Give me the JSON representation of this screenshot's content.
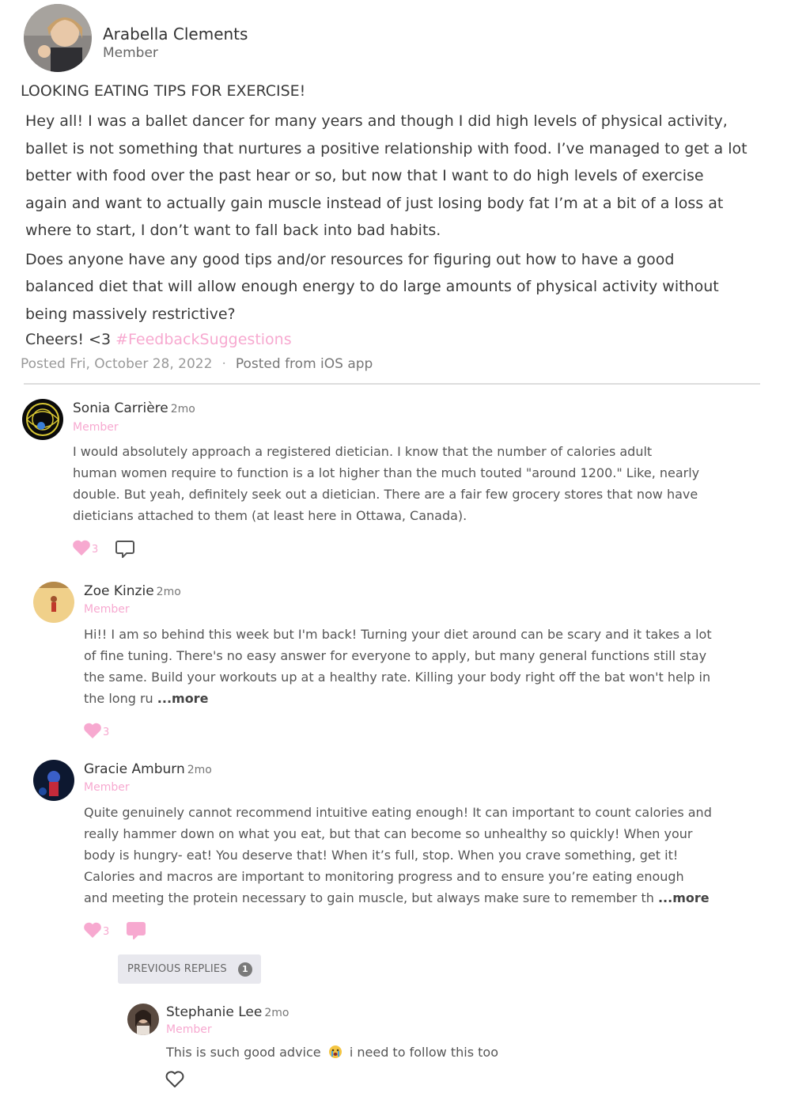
{
  "post": {
    "author": "Arabella Clements",
    "role": "Member",
    "title": "LOOKING EATING TIPS FOR EXERCISE!",
    "lines1": [
      "Hey all! I was a ballet dancer for many years and though I did high levels of physical activity,",
      "ballet is not something that nurtures a positive relationship with food. I’ve managed to get a lot",
      "better with food over the past hear or so, but now that I want to do high levels of exercise",
      "again and want to actually gain muscle instead of just losing body fat I’m at a bit of a loss at",
      "where to start, I don’t want to fall back into bad habits."
    ],
    "lines2": [
      "Does anyone have any good tips and/or resources for figuring out how to have a good",
      "balanced diet that will allow enough energy to do large amounts of physical activity without",
      "being massively restrictive?"
    ],
    "closing": "Cheers! <3",
    "hashtag": "#FeedbackSuggestions",
    "posted": "Posted Fri, October 28, 2022",
    "dot": "·",
    "source": "Posted from iOS app"
  },
  "comments": [
    {
      "name": "Sonia Carrière",
      "time": "2mo",
      "role": "Member",
      "lines": [
        "I would absolutely approach a registered dietician. I know that the number of calories adult",
        "human women require to function is a lot higher than the much touted \"around 1200.\" Like, nearly",
        "double. But yeah, definitely seek out a dietician. There are a fair few grocery stores that now have",
        "dieticians attached to them (at least here in Ottawa, Canada)."
      ],
      "likes": "3"
    },
    {
      "name": "Zoe Kinzie",
      "time": "2mo",
      "role": "Member",
      "lines": [
        "Hi!! I am so behind this week but I'm back! Turning your diet around can be scary and it takes a lot",
        "of fine tuning. There's no easy answer for everyone to apply, but many general functions still stay",
        "the same. Build your workouts up at a healthy rate. Killing your body right off the bat won't help in",
        "the long ru"
      ],
      "more": "...more",
      "likes": "3"
    },
    {
      "name": "Gracie Amburn",
      "time": "2mo",
      "role": "Member",
      "lines": [
        "Quite genuinely cannot recommend intuitive eating enough! It can important to count calories and",
        "really hammer down on what you eat, but that can become so unhealthy so quickly! When your",
        "body is hungry- eat! You deserve that! When it’s full, stop. When you crave something, get it!",
        "Calories and macros are important to monitoring progress and to ensure you’re eating enough",
        "and meeting the protein necessary to gain muscle, but always make sure to remember th"
      ],
      "more": "...more",
      "likes": "3"
    }
  ],
  "previous_replies": {
    "label": "PREVIOUS REPLIES",
    "count": "1"
  },
  "reply": {
    "name": "Stephanie Lee",
    "time": "2mo",
    "role": "Member",
    "text_before": "This is such good advice",
    "text_after": "i need to follow this too",
    "emoji": "crying-face-emoji"
  },
  "colors": {
    "accent_pink": "#f7a9d0",
    "divider": "#dddddd"
  }
}
